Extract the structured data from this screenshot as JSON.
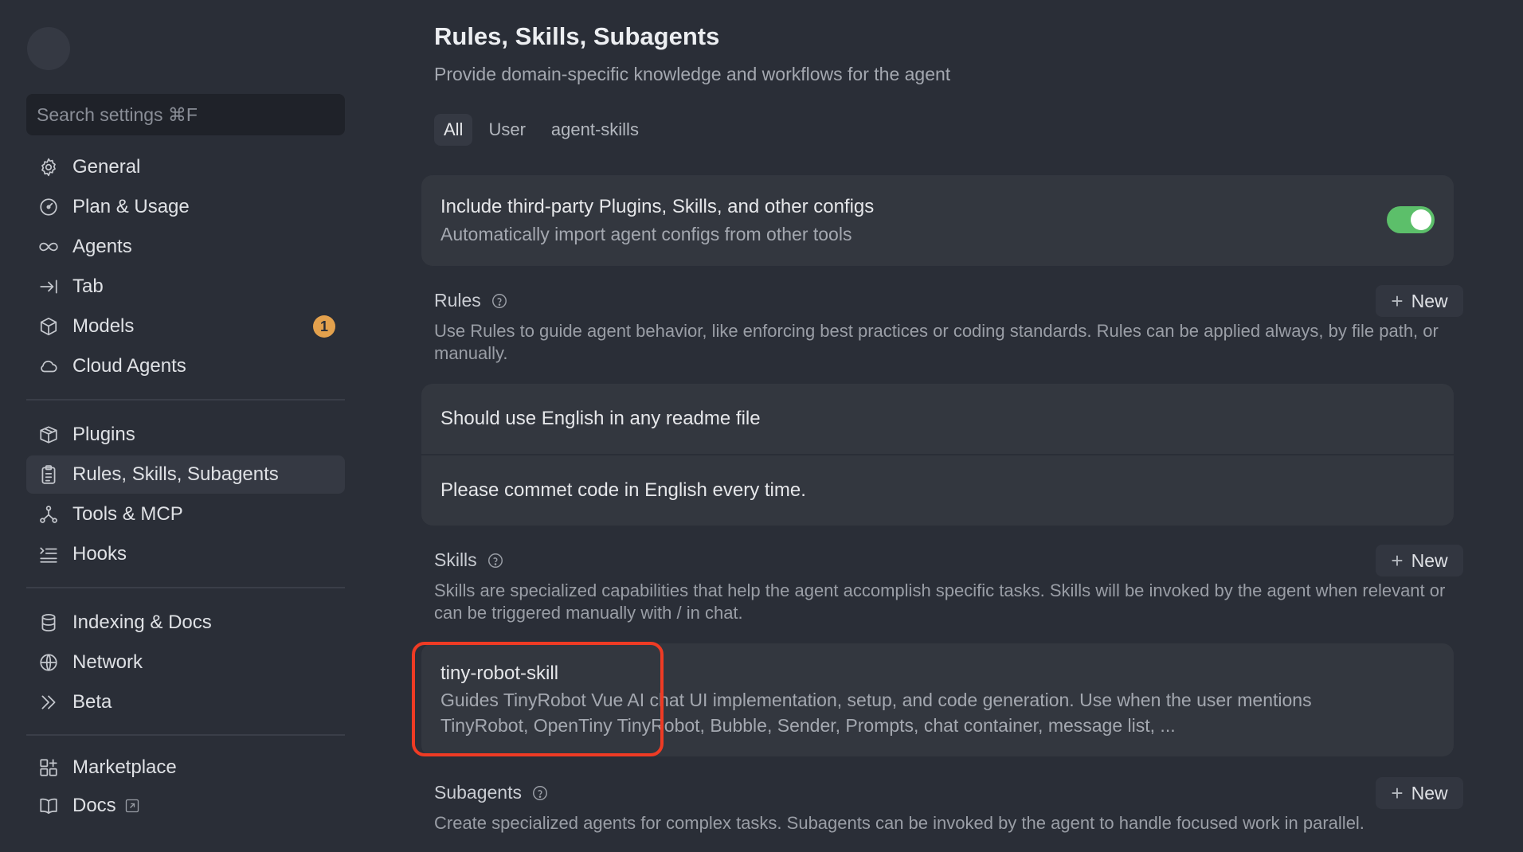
{
  "sidebar": {
    "search_placeholder": "Search settings ⌘F",
    "group1": [
      {
        "label": "General",
        "icon": "gear-icon"
      },
      {
        "label": "Plan & Usage",
        "icon": "gauge-icon"
      },
      {
        "label": "Agents",
        "icon": "infinity-icon"
      },
      {
        "label": "Tab",
        "icon": "tab-arrow-icon"
      },
      {
        "label": "Models",
        "icon": "cube-icon",
        "badge": "1"
      },
      {
        "label": "Cloud Agents",
        "icon": "cloud-icon"
      }
    ],
    "group2": [
      {
        "label": "Plugins",
        "icon": "package-icon"
      },
      {
        "label": "Rules, Skills, Subagents",
        "icon": "clipboard-icon",
        "active": true
      },
      {
        "label": "Tools & MCP",
        "icon": "nodes-icon"
      },
      {
        "label": "Hooks",
        "icon": "list-arrow-icon"
      }
    ],
    "group3": [
      {
        "label": "Indexing & Docs",
        "icon": "database-icon"
      },
      {
        "label": "Network",
        "icon": "globe-icon"
      },
      {
        "label": "Beta",
        "icon": "chevrons-right-icon"
      }
    ],
    "group4": [
      {
        "label": "Marketplace",
        "icon": "grid-plus-icon"
      },
      {
        "label": "Docs",
        "icon": "book-icon"
      }
    ]
  },
  "main": {
    "title": "Rules, Skills, Subagents",
    "subtitle": "Provide domain-specific knowledge and workflows for the agent",
    "tabs": [
      "All",
      "User",
      "agent-skills"
    ],
    "third_party": {
      "title": "Include third-party Plugins, Skills, and other configs",
      "description": "Automatically import agent configs from other tools",
      "enabled": true
    },
    "rules": {
      "heading": "Rules",
      "description": "Use Rules to guide agent behavior, like enforcing best practices or coding standards. Rules can be applied always, by file path, or manually.",
      "new_label": "New",
      "items": [
        "Should use English in any readme file",
        "Please commet code in English every time."
      ]
    },
    "skills": {
      "heading": "Skills",
      "description": "Skills are specialized capabilities that help the agent accomplish specific tasks. Skills will be invoked by the agent when relevant or can be triggered manually with / in chat.",
      "new_label": "New",
      "items": [
        {
          "name": "tiny-robot-skill",
          "description": "Guides TinyRobot Vue AI chat UI implementation, setup, and code generation. Use when the user mentions TinyRobot, OpenTiny TinyRobot, Bubble, Sender, Prompts, chat container, message list, ..."
        }
      ]
    },
    "subagents": {
      "heading": "Subagents",
      "description": "Create specialized agents for complex tasks. Subagents can be invoked by the agent to handle focused work in parallel.",
      "new_label": "New"
    }
  },
  "colors": {
    "background": "#2a2e37",
    "card": "#33373f",
    "toggle_on": "#5cbf6a",
    "badge": "#e3a14d",
    "highlight": "#ef3b24"
  }
}
